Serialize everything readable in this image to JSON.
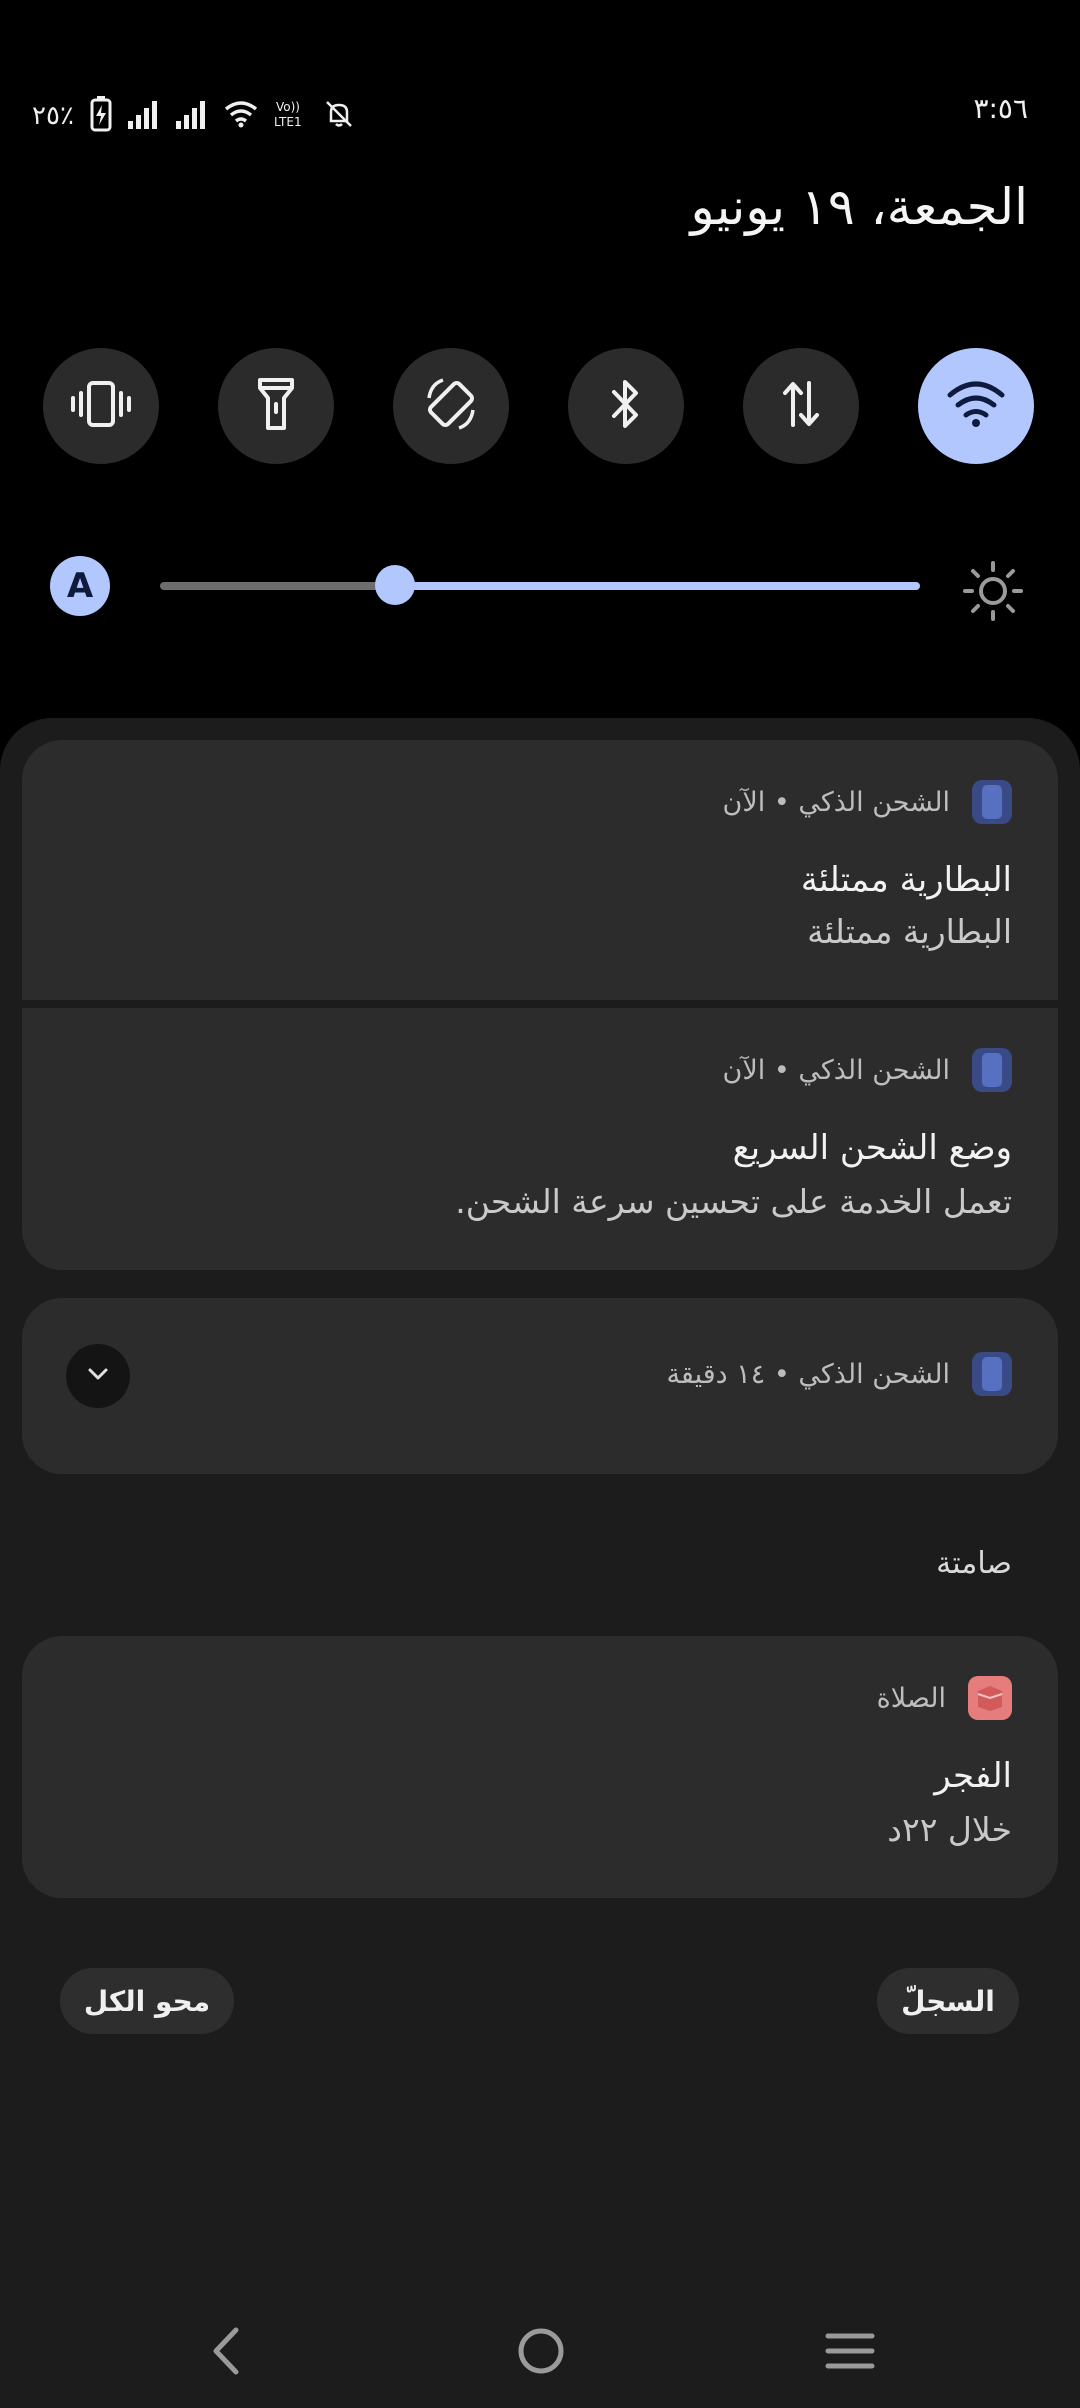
{
  "status_bar": {
    "time": "٣:٥٦",
    "battery_percent": "٢٥٪"
  },
  "date": "الجمعة، ١٩ يونيو",
  "quick_tiles": [
    {
      "name": "wifi",
      "active": true
    },
    {
      "name": "mobile-data",
      "active": false
    },
    {
      "name": "bluetooth",
      "active": false
    },
    {
      "name": "auto-rotate",
      "active": false
    },
    {
      "name": "flashlight",
      "active": false
    },
    {
      "name": "vibrate",
      "active": false
    }
  ],
  "brightness": {
    "auto_label": "A",
    "level": 0.31
  },
  "notifications": [
    {
      "header": "الشحن الذكي • الآن",
      "title": "البطارية ممتلئة",
      "body": "البطارية ممتلئة"
    },
    {
      "header": "الشحن الذكي • الآن",
      "title": "وضع الشحن السريع",
      "body": "تعمل الخدمة على تحسين سرعة الشحن."
    },
    {
      "header": "الشحن الذكي • ١٤ دقيقة"
    }
  ],
  "silent_section": {
    "label": "صامتة",
    "notification": {
      "header": "الصلاة",
      "title": "الفجر",
      "body": "خلال ٢٢د"
    }
  },
  "actions": {
    "clear_all": "محو الكل",
    "history": "السجلّ"
  },
  "colors": {
    "accent": "#b3c7ff",
    "card": "#2c2c2c",
    "shade": "#1c1c1c"
  }
}
